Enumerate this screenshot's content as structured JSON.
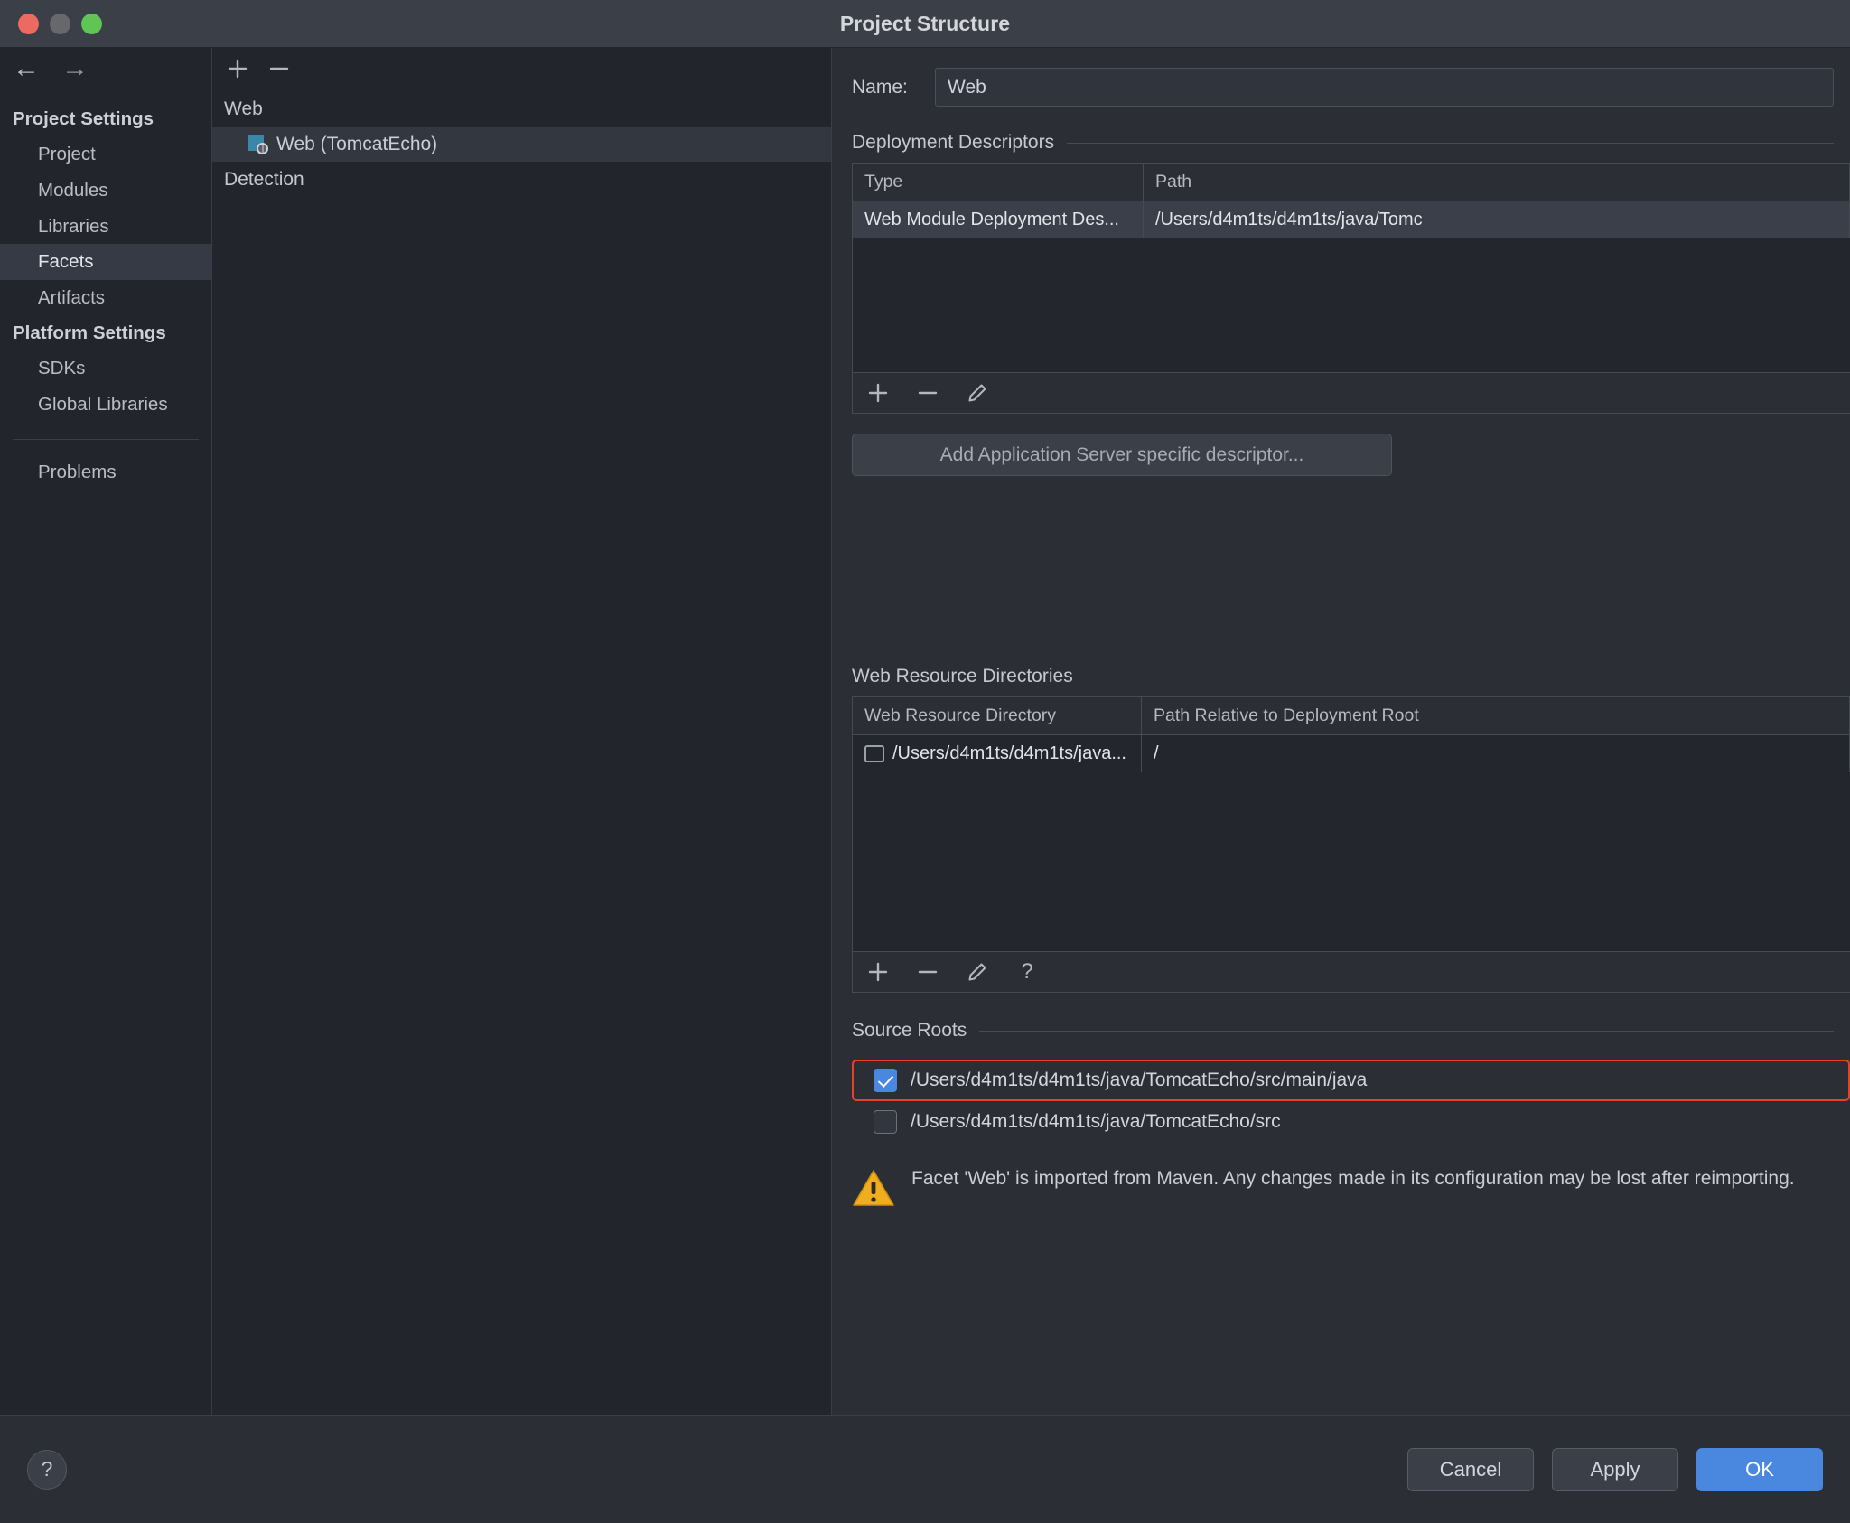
{
  "window": {
    "title": "Project Structure"
  },
  "nav": {
    "back_icon": "arrow-left-icon",
    "forward_icon": "arrow-right-icon"
  },
  "sidebar": {
    "groups": [
      {
        "label": "Project Settings"
      }
    ],
    "project_settings_label": "Project Settings",
    "platform_settings_label": "Platform Settings",
    "items": [
      {
        "label": "Project",
        "selected": false
      },
      {
        "label": "Modules",
        "selected": false
      },
      {
        "label": "Libraries",
        "selected": false
      },
      {
        "label": "Facets",
        "selected": true
      },
      {
        "label": "Artifacts",
        "selected": false
      }
    ],
    "platform_items": [
      {
        "label": "SDKs",
        "selected": false
      },
      {
        "label": "Global Libraries",
        "selected": false
      }
    ],
    "problems_label": "Problems"
  },
  "center": {
    "toolbar": {
      "add_label": "+",
      "remove_label": "−"
    },
    "group_label": "Web",
    "node_label": "Web (TomcatEcho)",
    "detection_label": "Detection"
  },
  "details": {
    "name_label": "Name:",
    "name_value": "Web",
    "deployment_descriptors": {
      "title": "Deployment Descriptors",
      "columns": [
        "Type",
        "Path"
      ],
      "rows": [
        {
          "type": "Web Module Deployment Des...",
          "path": "/Users/d4m1ts/d4m1ts/java/Tomc"
        }
      ],
      "add_descriptor_button": "Add Application Server specific descriptor..."
    },
    "web_resource_directories": {
      "title": "Web Resource Directories",
      "columns": [
        "Web Resource Directory",
        "Path Relative to Deployment Root"
      ],
      "rows": [
        {
          "directory": "/Users/d4m1ts/d4m1ts/java...",
          "relative_path": "/"
        }
      ]
    },
    "source_roots": {
      "title": "Source Roots",
      "items": [
        {
          "path": "/Users/d4m1ts/d4m1ts/java/TomcatEcho/src/main/java",
          "checked": true,
          "highlighted": true
        },
        {
          "path": "/Users/d4m1ts/d4m1ts/java/TomcatEcho/src",
          "checked": false,
          "highlighted": false
        }
      ]
    },
    "warning": "Facet 'Web' is imported from Maven. Any changes made in its configuration may be lost after reimporting."
  },
  "footer": {
    "help_label": "?",
    "cancel_label": "Cancel",
    "apply_label": "Apply",
    "ok_label": "OK"
  },
  "colors": {
    "accent": "#4a88e0",
    "highlight_border": "#e8412a",
    "warning": "#f0ad1e",
    "facet_icon": "#3b87a8"
  }
}
